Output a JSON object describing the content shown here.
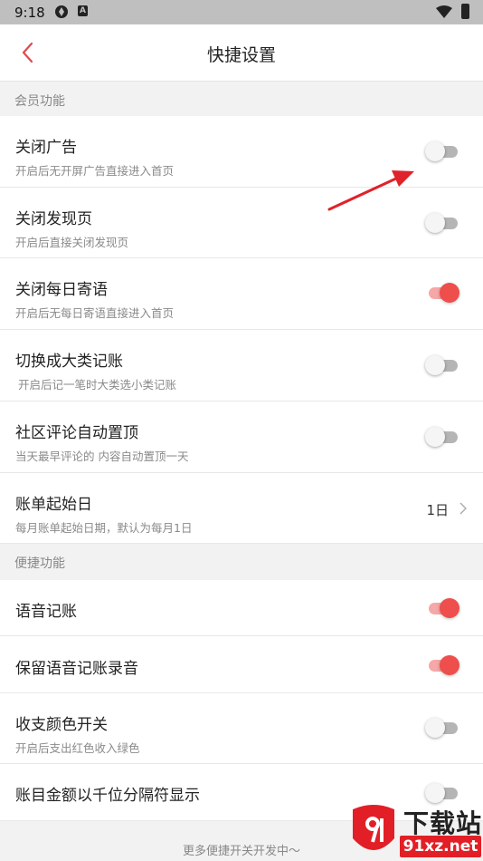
{
  "status_bar": {
    "time": "9:18",
    "a_badge": "A"
  },
  "header": {
    "title": "快捷设置"
  },
  "sections": [
    {
      "title": "会员功能"
    },
    {
      "title": "便捷功能"
    }
  ],
  "rows": [
    {
      "label": "关闭广告",
      "sub": "开启后无开屏广告直接进入首页",
      "toggle_on": false
    },
    {
      "label": "关闭发现页",
      "sub": "开启后直接关闭发现页",
      "toggle_on": false
    },
    {
      "label": "关闭每日寄语",
      "sub": "开启后无每日寄语直接进入首页",
      "toggle_on": true
    },
    {
      "label": "切换成大类记账",
      "sub": "开启后记一笔时大类选小类记账",
      "toggle_on": false
    },
    {
      "label": "社区评论自动置顶",
      "sub": "当天最早评论的 内容自动置顶一天",
      "toggle_on": false
    },
    {
      "label": "账单起始日",
      "sub": "每月账单起始日期，默认为每月1日",
      "value": "1日"
    },
    {
      "label": "语音记账",
      "toggle_on": true
    },
    {
      "label": "保留语音记账录音",
      "toggle_on": true
    },
    {
      "label": "收支颜色开关",
      "sub": "开启后支出红色收入绿色",
      "toggle_on": false
    },
    {
      "label": "账目金额以千位分隔符显示",
      "toggle_on": false
    }
  ],
  "footer": {
    "text": "更多便捷开关开发中～"
  },
  "watermark": {
    "top": "下载站",
    "bottom": "91xz.net"
  },
  "colors": {
    "accent": "#ee4e4c",
    "accent_track": "#f6a7a7",
    "off_track": "#b5b5b5",
    "arrow": "#e0222a"
  }
}
